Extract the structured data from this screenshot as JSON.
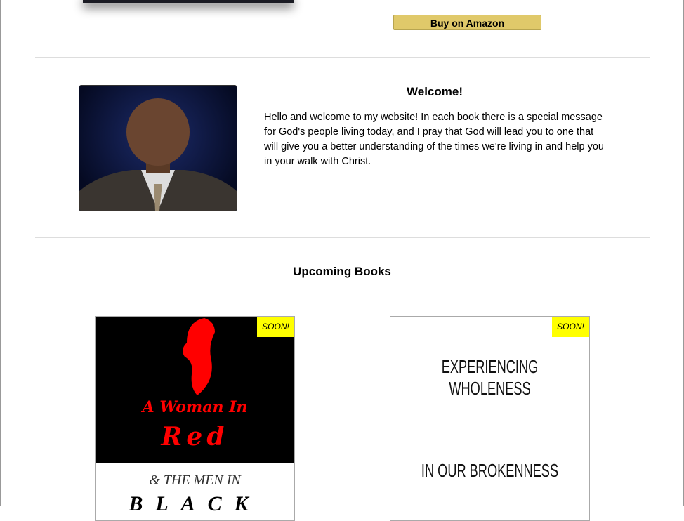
{
  "top_book": {
    "buy_label": "Buy on Amazon"
  },
  "welcome": {
    "title": "Welcome!",
    "text": "Hello and welcome to my website! In each book there is a special message for God's people living today, and I pray that God will lead you to one that will give you a better understanding of the times we're living in and help you in your walk with Christ."
  },
  "upcoming": {
    "title": "Upcoming Books",
    "books": [
      {
        "badge": "SOON!",
        "cover_lines": [
          "A Woman In",
          "Red",
          "& THE MEN IN",
          "BLACK"
        ]
      },
      {
        "badge": "SOON!",
        "cover_lines": [
          "EXPERIENCING WHOLENESS",
          "IN OUR BROKENNESS"
        ]
      }
    ]
  },
  "colors": {
    "amazon_button": "#e0c96a",
    "badge": "#ffff00",
    "accent_red": "#ff0000"
  }
}
